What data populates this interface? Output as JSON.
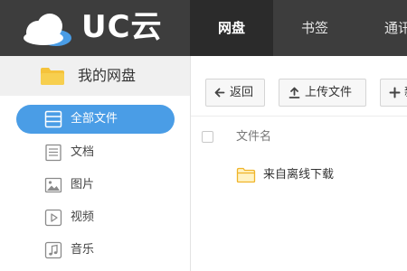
{
  "app": {
    "brand_text": "UC云",
    "logo_icon": "cloud-icon"
  },
  "nav": {
    "tabs": [
      {
        "label": "网盘",
        "active": true
      },
      {
        "label": "书签",
        "active": false
      },
      {
        "label": "通讯"
      }
    ]
  },
  "sidebar": {
    "title": "我的网盘",
    "items": [
      {
        "label": "全部文件",
        "icon": "all-files-icon",
        "active": true
      },
      {
        "label": "文档",
        "icon": "document-icon"
      },
      {
        "label": "图片",
        "icon": "image-icon"
      },
      {
        "label": "视频",
        "icon": "video-icon"
      },
      {
        "label": "音乐",
        "icon": "music-icon"
      }
    ]
  },
  "toolbar": {
    "back_label": "返回",
    "upload_label": "上传文件",
    "new_label": "新"
  },
  "file_list": {
    "column_name": "文件名",
    "rows": [
      {
        "name": "来自离线下载",
        "type": "folder"
      }
    ]
  },
  "colors": {
    "header_bg": "#3d3d3d",
    "accent": "#4a9de6",
    "folder": "#f5c33b"
  }
}
